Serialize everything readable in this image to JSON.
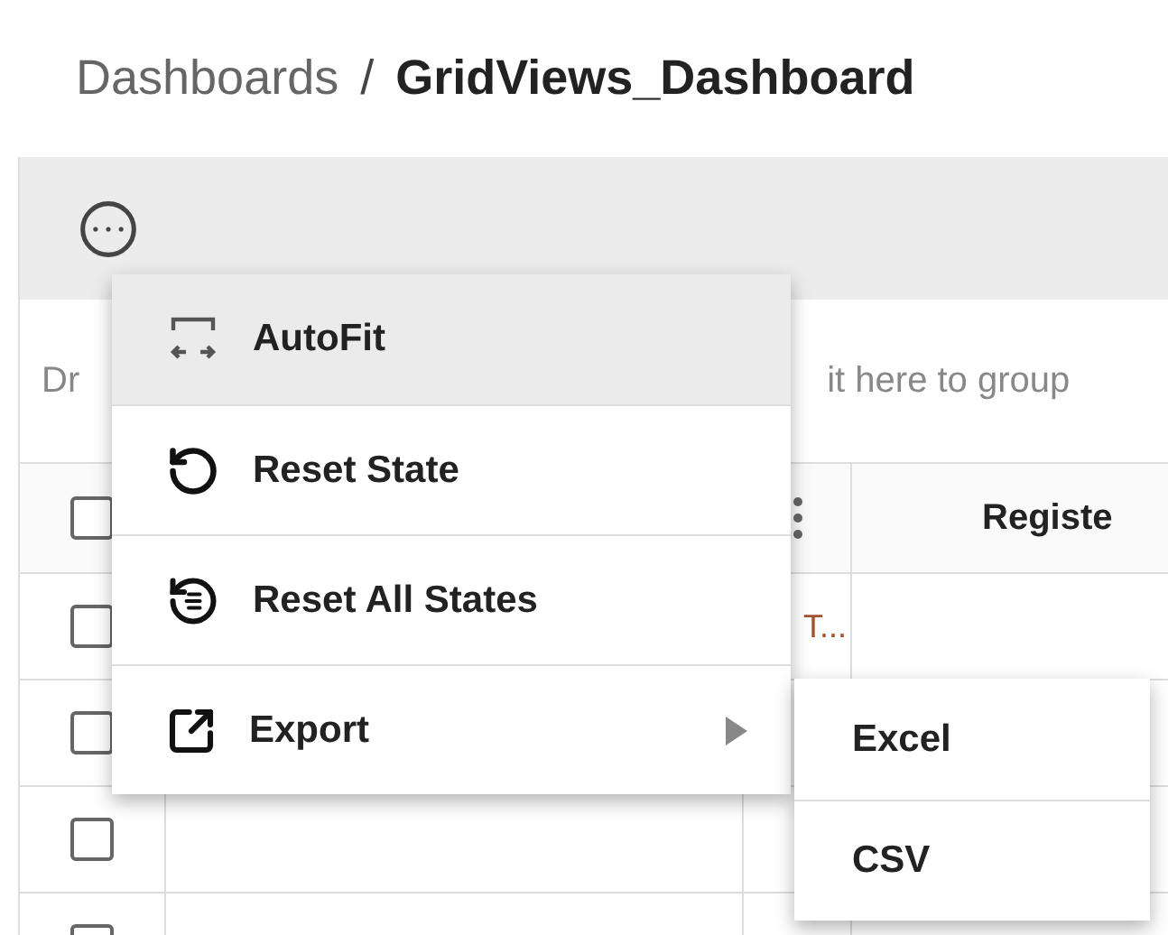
{
  "breadcrumb": {
    "parent": "Dashboards",
    "separator": "/",
    "current": "GridViews_Dashboard"
  },
  "group_panel": {
    "text_left": "Dr",
    "text_right": "it here to group"
  },
  "table": {
    "header": {
      "checked": false,
      "column_4": "Registe"
    },
    "rows": [
      {
        "checked": false,
        "column_3": "T..."
      },
      {
        "checked": false
      },
      {
        "checked": false
      },
      {
        "checked": false
      }
    ]
  },
  "menu": {
    "items": [
      {
        "label": "AutoFit",
        "kind": "autofit",
        "selected": true,
        "has_submenu": false
      },
      {
        "label": "Reset State",
        "kind": "reset",
        "selected": false,
        "has_submenu": false
      },
      {
        "label": "Reset All States",
        "kind": "reset_all",
        "selected": false,
        "has_submenu": false
      },
      {
        "label": "Export",
        "kind": "export",
        "selected": false,
        "has_submenu": true
      }
    ]
  },
  "submenu": {
    "items": [
      {
        "label": "Excel"
      },
      {
        "label": "CSV"
      }
    ]
  }
}
